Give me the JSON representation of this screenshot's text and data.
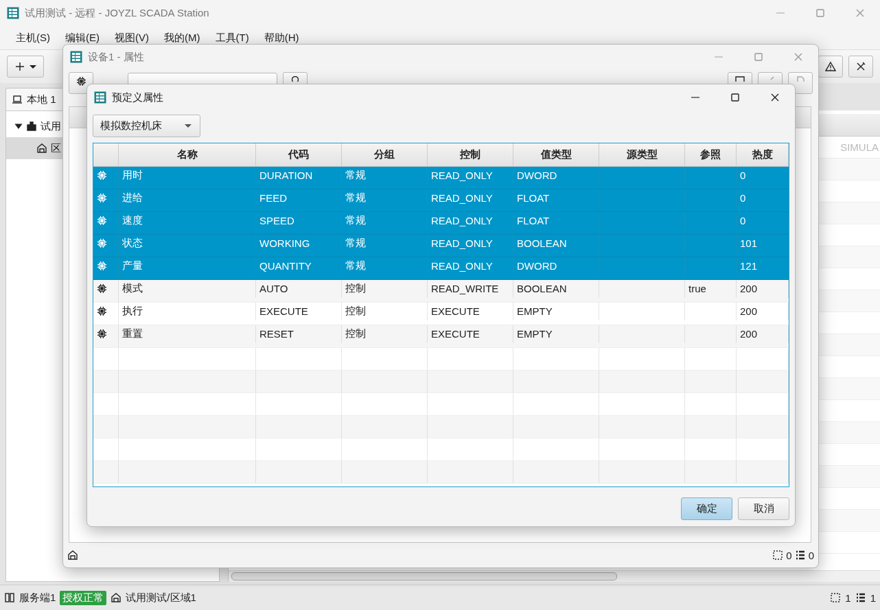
{
  "main_window": {
    "title": "试用测试 - 远程 - JOYZL SCADA Station",
    "menu": [
      "主机(S)",
      "编辑(E)",
      "视图(V)",
      "我的(M)",
      "工具(T)",
      "帮助(H)"
    ],
    "tabs": [
      {
        "label": "本地 1",
        "selected": true
      }
    ],
    "tree": [
      {
        "label": "试用",
        "expanded": true,
        "selected": false,
        "children": [
          {
            "label": "区",
            "selected": true
          }
        ]
      }
    ],
    "table_cell": "SIMULA",
    "status_bar": {
      "server": "服务端1",
      "license": "授权正常",
      "path": "试用测试/区域1",
      "selected_count": "1",
      "item_count": "1"
    }
  },
  "device_dialog": {
    "title": "设备1 - 属性",
    "status_bar": {
      "selected_count": "0",
      "item_count": "0"
    }
  },
  "predefined_dialog": {
    "title": "预定义属性",
    "template": "模拟数控机床",
    "columns": [
      "名称",
      "代码",
      "分组",
      "控制",
      "值类型",
      "源类型",
      "参照",
      "热度"
    ],
    "rows": [
      {
        "name": "用时",
        "code": "DURATION",
        "group": "常规",
        "control": "READ_ONLY",
        "value_type": "DWORD",
        "reference": "",
        "heat": "0",
        "selected": true
      },
      {
        "name": "进给",
        "code": "FEED",
        "group": "常规",
        "control": "READ_ONLY",
        "value_type": "FLOAT",
        "reference": "",
        "heat": "0",
        "selected": true
      },
      {
        "name": "速度",
        "code": "SPEED",
        "group": "常规",
        "control": "READ_ONLY",
        "value_type": "FLOAT",
        "reference": "",
        "heat": "0",
        "selected": true
      },
      {
        "name": "状态",
        "code": "WORKING",
        "group": "常规",
        "control": "READ_ONLY",
        "value_type": "BOOLEAN",
        "reference": "",
        "heat": "101",
        "selected": true
      },
      {
        "name": "产量",
        "code": "QUANTITY",
        "group": "常规",
        "control": "READ_ONLY",
        "value_type": "DWORD",
        "reference": "",
        "heat": "121",
        "selected": true
      },
      {
        "name": "模式",
        "code": "AUTO",
        "group": "控制",
        "control": "READ_WRITE",
        "value_type": "BOOLEAN",
        "reference": "true",
        "heat": "200",
        "selected": false
      },
      {
        "name": "执行",
        "code": "EXECUTE",
        "group": "控制",
        "control": "EXECUTE",
        "value_type": "EMPTY",
        "reference": "",
        "heat": "200",
        "selected": false
      },
      {
        "name": "重置",
        "code": "RESET",
        "group": "控制",
        "control": "EXECUTE",
        "value_type": "EMPTY",
        "reference": "",
        "heat": "200",
        "selected": false
      }
    ],
    "buttons": [
      {
        "label": "确定",
        "primary": true
      },
      {
        "label": "取消",
        "primary": false
      }
    ]
  }
}
